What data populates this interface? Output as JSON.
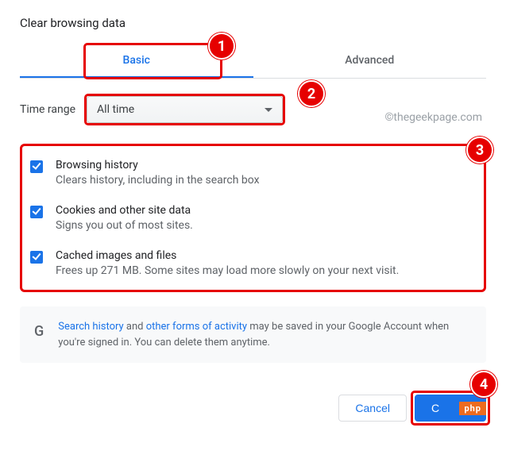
{
  "title": "Clear browsing data",
  "tabs": {
    "basic": "Basic",
    "advanced": "Advanced"
  },
  "time_range": {
    "label": "Time range",
    "value": "All time"
  },
  "watermark": "©thegeekpage.com",
  "options": [
    {
      "title": "Browsing history",
      "desc": "Clears history, including in the search box"
    },
    {
      "title": "Cookies and other site data",
      "desc": "Signs you out of most sites."
    },
    {
      "title": "Cached images and files",
      "desc": "Frees up 271 MB. Some sites may load more slowly on your next visit."
    }
  ],
  "info": {
    "link1": "Search history",
    "mid1": " and ",
    "link2": "other forms of activity",
    "tail": " may be saved in your Google Account when you're signed in. You can delete them anytime."
  },
  "buttons": {
    "cancel": "Cancel",
    "confirm": "C"
  },
  "callouts": {
    "c1": "1",
    "c2": "2",
    "c3": "3",
    "c4": "4"
  },
  "overlay": "php"
}
